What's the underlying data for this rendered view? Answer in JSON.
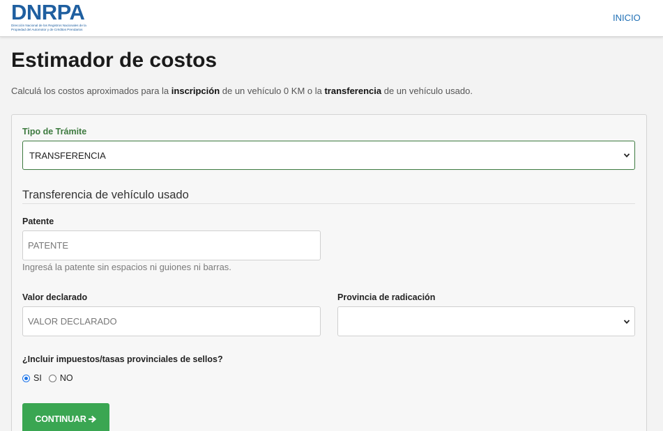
{
  "header": {
    "logo_text": "DNRPA",
    "logo_subtitle_line1": "Dirección Nacional de los Registros Nacionales de la",
    "logo_subtitle_line2": "Propiedad del Automotor y de Créditos Prendarios",
    "nav_inicio": "INICIO"
  },
  "page": {
    "title": "Estimador de costos",
    "intro_part1": "Calculá los costos aproximados para la ",
    "intro_bold1": "inscripción",
    "intro_part2": " de un vehículo 0 KM o la ",
    "intro_bold2": "transferencia",
    "intro_part3": " de un vehículo usado."
  },
  "form": {
    "tipo_label": "Tipo de Trámite",
    "tipo_value": "TRANSFERENCIA",
    "section_title": "Transferencia de vehículo usado",
    "patente_label": "Patente",
    "patente_placeholder": "PATENTE",
    "patente_help": "Ingresá la patente sin espacios ni guiones ni barras.",
    "valor_label": "Valor declarado",
    "valor_placeholder": "VALOR DECLARADO",
    "provincia_label": "Provincia de radicación",
    "provincia_value": "",
    "impuestos_label": "¿Incluir impuestos/tasas provinciales de sellos?",
    "opcion_si": "SI",
    "opcion_no": "NO",
    "selected_option": "SI",
    "continue_label": "CONTINUAR"
  },
  "colors": {
    "brand_blue": "#1f5fa0",
    "accent_green": "#3d7a3f",
    "button_green": "#3aa652"
  }
}
